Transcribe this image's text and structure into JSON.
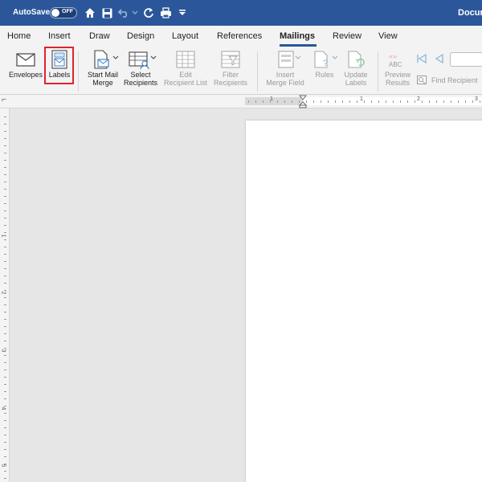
{
  "titlebar": {
    "autosave_label": "AutoSave",
    "autosave_state": "OFF",
    "document_title": "Docum"
  },
  "tabs": [
    {
      "label": "Home"
    },
    {
      "label": "Insert"
    },
    {
      "label": "Draw"
    },
    {
      "label": "Design"
    },
    {
      "label": "Layout"
    },
    {
      "label": "References"
    },
    {
      "label": "Mailings",
      "active": true
    },
    {
      "label": "Review"
    },
    {
      "label": "View"
    }
  ],
  "ribbon": {
    "envelopes": "Envelopes",
    "labels": "Labels",
    "start_mail_merge_1": "Start Mail",
    "start_mail_merge_2": "Merge",
    "select_recipients_1": "Select",
    "select_recipients_2": "Recipients",
    "edit_recipient_list_1": "Edit",
    "edit_recipient_list_2": "Recipient List",
    "filter_recipients_1": "Filter",
    "filter_recipients_2": "Recipients",
    "insert_merge_field_1": "Insert",
    "insert_merge_field_2": "Merge Field",
    "rules": "Rules",
    "update_labels_1": "Update",
    "update_labels_2": "Labels",
    "preview_results_1": "Preview",
    "preview_results_2": "Results",
    "preview_abc": "ABC",
    "find_recipient": "Find Recipient"
  },
  "ruler": {
    "h_numbers": [
      "1",
      "1",
      "2",
      "3"
    ],
    "v_numbers": [
      "1",
      "2",
      "3",
      "4",
      "5"
    ]
  },
  "colors": {
    "title_blue": "#2b579a",
    "highlight_red": "#e0232f"
  }
}
